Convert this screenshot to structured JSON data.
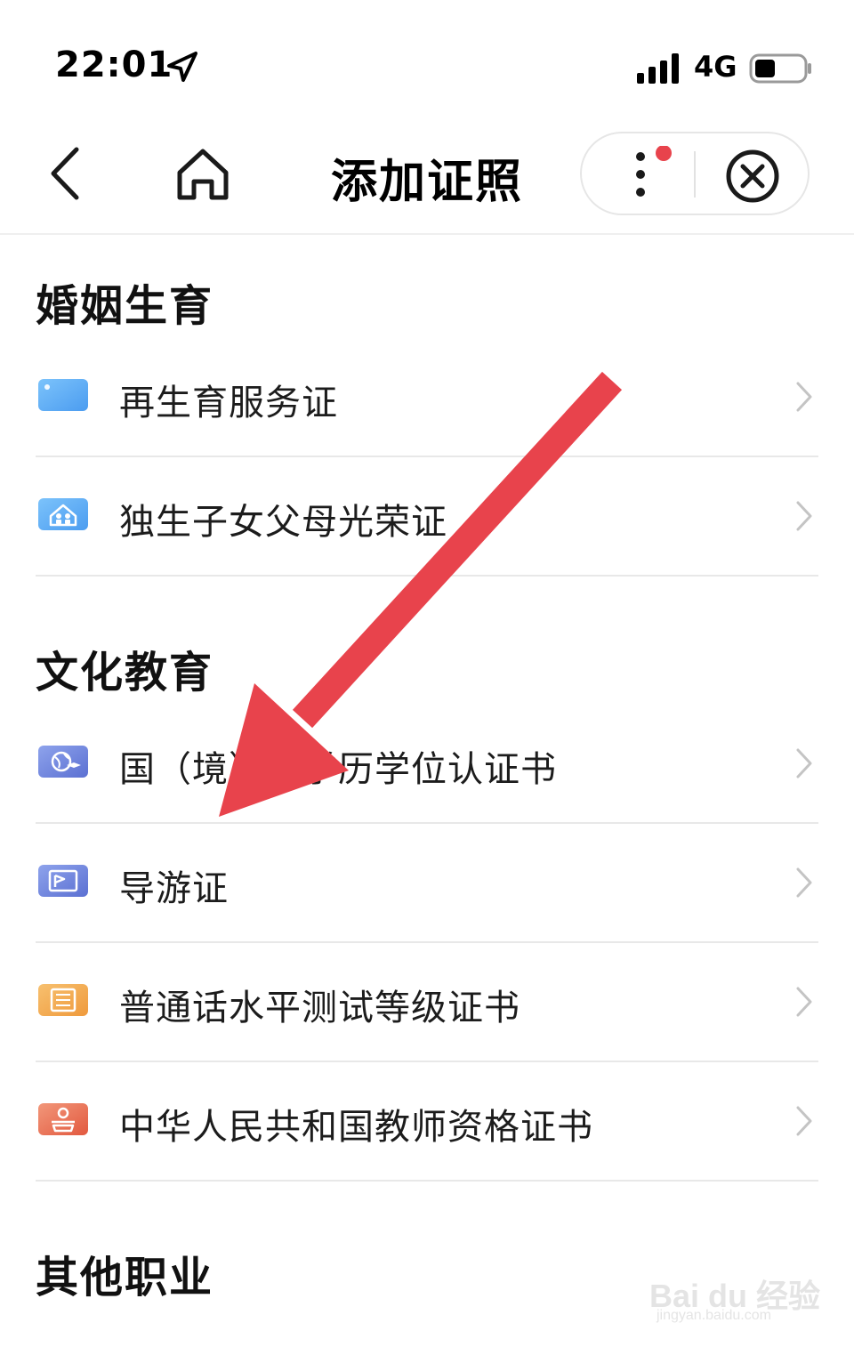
{
  "status": {
    "time": "22:01",
    "network": "4G"
  },
  "nav": {
    "title": "添加证照"
  },
  "sections": [
    {
      "title": "婚姻生育",
      "items": [
        {
          "label": "再生育服务证",
          "icon": "card-icon",
          "color": "#5aa9f2"
        },
        {
          "label": "独生子女父母光荣证",
          "icon": "family-house-icon",
          "color": "#5aa9f2"
        }
      ]
    },
    {
      "title": "文化教育",
      "items": [
        {
          "label": "国（境）外学历学位认证书",
          "icon": "globe-graduation-icon",
          "color": "#6a7fd6"
        },
        {
          "label": "导游证",
          "icon": "guide-flag-icon",
          "color": "#6a7fd6"
        },
        {
          "label": "普通话水平测试等级证书",
          "icon": "putonghua-cert-icon",
          "color": "#f2a64c"
        },
        {
          "label": "中华人民共和国教师资格证书",
          "icon": "teacher-podium-icon",
          "color": "#e8735a"
        }
      ]
    },
    {
      "title": "其他职业",
      "items": []
    }
  ],
  "annotation": {
    "arrow_color": "#e8434c"
  },
  "watermark": {
    "brand": "Bai du 经验",
    "url": "jingyan.baidu.com"
  }
}
